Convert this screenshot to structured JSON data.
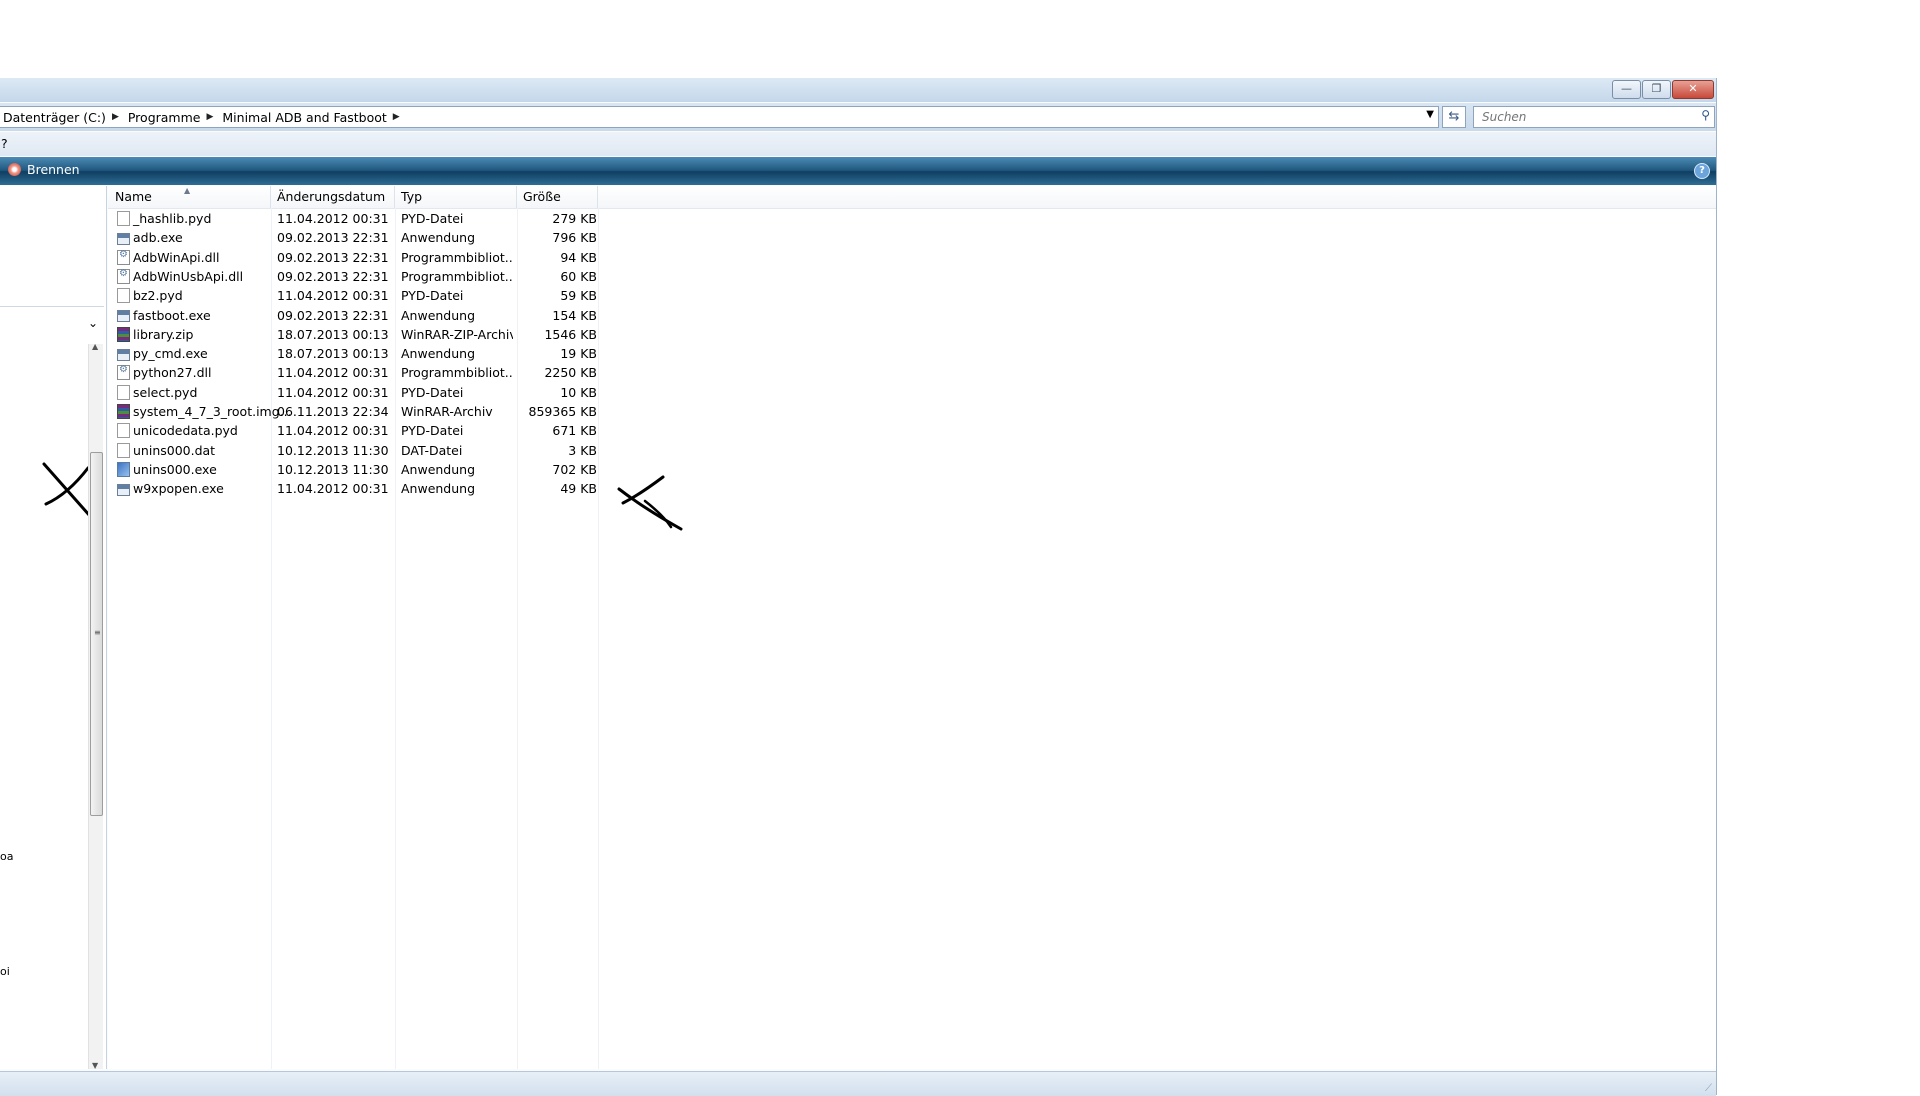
{
  "window": {
    "buttons": {
      "minimize": "—",
      "maximize": "❐",
      "close": "✕"
    }
  },
  "address": {
    "crumbs": [
      "Datenträger (C:)",
      "Programme",
      "Minimal ADB and Fastboot"
    ],
    "search_placeholder": "Suchen"
  },
  "menu": {
    "help": "?"
  },
  "commandbar": {
    "burn_label": "Brennen",
    "help_label": "?"
  },
  "navpane": {
    "text_a": "oa",
    "text_b": "oi"
  },
  "columns": {
    "name": "Name",
    "date": "Änderungsdatum",
    "type": "Typ",
    "size": "Größe"
  },
  "files": [
    {
      "name": "_hashlib.pyd",
      "date": "11.04.2012 00:31",
      "type": "PYD-Datei",
      "size": "279 KB",
      "icon": "document-icon"
    },
    {
      "name": "adb.exe",
      "date": "09.02.2013 22:31",
      "type": "Anwendung",
      "size": "796 KB",
      "icon": "exe-icon"
    },
    {
      "name": "AdbWinApi.dll",
      "date": "09.02.2013 22:31",
      "type": "Programmbibliot...",
      "size": "94 KB",
      "icon": "dll-icon"
    },
    {
      "name": "AdbWinUsbApi.dll",
      "date": "09.02.2013 22:31",
      "type": "Programmbibliot...",
      "size": "60 KB",
      "icon": "dll-icon"
    },
    {
      "name": "bz2.pyd",
      "date": "11.04.2012 00:31",
      "type": "PYD-Datei",
      "size": "59 KB",
      "icon": "document-icon"
    },
    {
      "name": "fastboot.exe",
      "date": "09.02.2013 22:31",
      "type": "Anwendung",
      "size": "154 KB",
      "icon": "exe-icon"
    },
    {
      "name": "library.zip",
      "date": "18.07.2013 00:13",
      "type": "WinRAR-ZIP-Archiv",
      "size": "1546 KB",
      "icon": "winrar-icon"
    },
    {
      "name": "py_cmd.exe",
      "date": "18.07.2013 00:13",
      "type": "Anwendung",
      "size": "19 KB",
      "icon": "exe-icon"
    },
    {
      "name": "python27.dll",
      "date": "11.04.2012 00:31",
      "type": "Programmbibliot...",
      "size": "2250 KB",
      "icon": "dll-icon"
    },
    {
      "name": "select.pyd",
      "date": "11.04.2012 00:31",
      "type": "PYD-Datei",
      "size": "10 KB",
      "icon": "document-icon"
    },
    {
      "name": "system_4_7_3_root.img...",
      "date": "06.11.2013 22:34",
      "type": "WinRAR-Archiv",
      "size": "859365 KB",
      "icon": "winrar-icon"
    },
    {
      "name": "unicodedata.pyd",
      "date": "11.04.2012 00:31",
      "type": "PYD-Datei",
      "size": "671 KB",
      "icon": "document-icon"
    },
    {
      "name": "unins000.dat",
      "date": "10.12.2013 11:30",
      "type": "DAT-Datei",
      "size": "3 KB",
      "icon": "document-icon"
    },
    {
      "name": "unins000.exe",
      "date": "10.12.2013 11:30",
      "type": "Anwendung",
      "size": "702 KB",
      "icon": "setup-icon"
    },
    {
      "name": "w9xpopen.exe",
      "date": "11.04.2012 00:31",
      "type": "Anwendung",
      "size": "49 KB",
      "icon": "exe-icon"
    }
  ],
  "colors": {
    "commandbar": "#20577e",
    "titlebar": "#c4d7ea",
    "close": "#c7493a"
  }
}
